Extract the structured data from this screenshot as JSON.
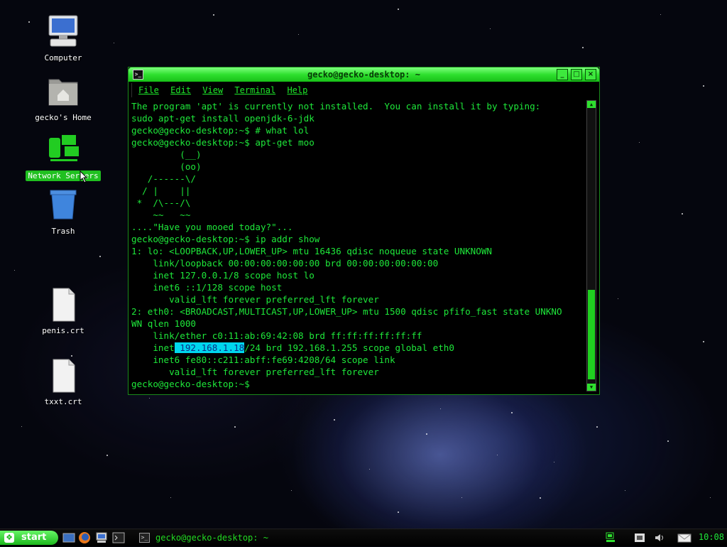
{
  "desktop": {
    "icons": [
      {
        "label": "Computer"
      },
      {
        "label": "gecko's Home"
      },
      {
        "label": "Network Servers"
      },
      {
        "label": "Trash"
      },
      {
        "label": "penis.crt"
      },
      {
        "label": "txxt.crt"
      }
    ]
  },
  "terminal": {
    "title": "gecko@gecko-desktop: ~",
    "menu": [
      "File",
      "Edit",
      "View",
      "Terminal",
      "Help"
    ],
    "output": {
      "before_highlight": "The program 'apt' is currently not installed.  You can install it by typing:\nsudo apt-get install openjdk-6-jdk\ngecko@gecko-desktop:~$ # what lol\ngecko@gecko-desktop:~$ apt-get moo\n         (__)\n         (oo)\n   /------\\/\n  / |    ||\n *  /\\---/\\\n    ~~   ~~\n....\"Have you mooed today?\"...\ngecko@gecko-desktop:~$ ip addr show\n1: lo: <LOOPBACK,UP,LOWER_UP> mtu 16436 qdisc noqueue state UNKNOWN\n    link/loopback 00:00:00:00:00:00 brd 00:00:00:00:00:00\n    inet 127.0.0.1/8 scope host lo\n    inet6 ::1/128 scope host\n       valid_lft forever preferred_lft forever\n2: eth0: <BROADCAST,MULTICAST,UP,LOWER_UP> mtu 1500 qdisc pfifo_fast state UNKNO\nWN qlen 1000\n    link/ether c0:11:ab:69:42:08 brd ff:ff:ff:ff:ff:ff\n    inet",
      "highlight": " 192.168.1.18",
      "after_highlight": "/24 brd 192.168.1.255 scope global eth0\n    inet6 fe80::c211:abff:fe69:4208/64 scope link\n       valid_lft forever preferred_lft forever\ngecko@gecko-desktop:~$ "
    }
  },
  "taskbar": {
    "start_label": "start",
    "task_title": "gecko@gecko-desktop: ~",
    "clock": "10:08"
  },
  "colors": {
    "accent_green": "#2ee02e",
    "terminal_text": "#1ee83a",
    "selection": "#00d7ee"
  }
}
